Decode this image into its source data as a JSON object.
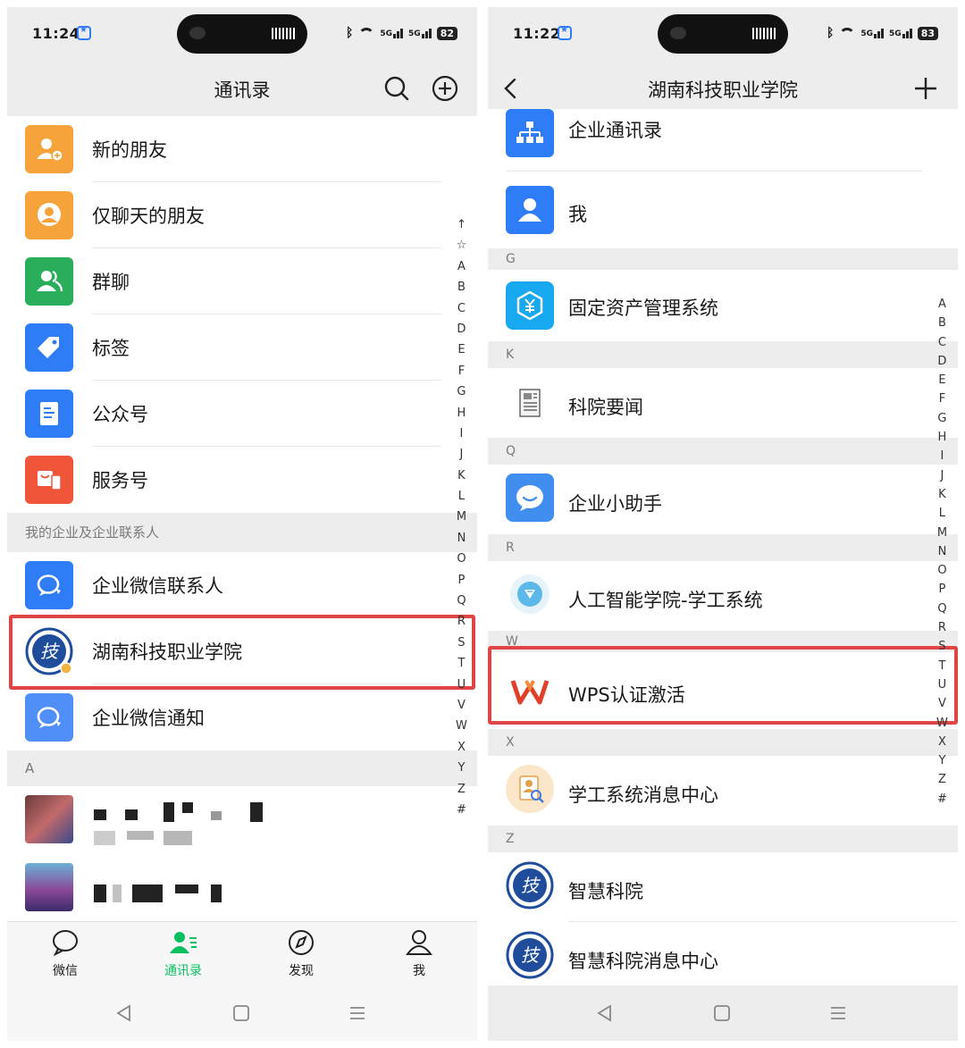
{
  "left": {
    "status": {
      "time": "11:24",
      "battery": "82",
      "sig1": "5G",
      "sig2": "5G"
    },
    "title": "通讯录",
    "menu": [
      {
        "label": "新的朋友",
        "icon": "new-friend-icon",
        "color": "#f5a33a"
      },
      {
        "label": "仅聊天的朋友",
        "icon": "chat-only-friend-icon",
        "color": "#f5a33a"
      },
      {
        "label": "群聊",
        "icon": "group-chat-icon",
        "color": "#2bae5b"
      },
      {
        "label": "标签",
        "icon": "tag-icon",
        "color": "#2e7cf6"
      },
      {
        "label": "公众号",
        "icon": "official-account-icon",
        "color": "#2e7cf6"
      },
      {
        "label": "服务号",
        "icon": "service-account-icon",
        "color": "#f0553a"
      }
    ],
    "enterprise_section": "我的企业及企业联系人",
    "enterprise": [
      {
        "label": "企业微信联系人",
        "icon": "wecom-contact-icon"
      },
      {
        "label": "湖南科技职业学院",
        "icon": "college-logo-icon"
      },
      {
        "label": "企业微信通知",
        "icon": "wecom-notice-icon"
      }
    ],
    "section_a": "A",
    "index_top": [
      "↑",
      "☆"
    ],
    "index": [
      "A",
      "B",
      "C",
      "D",
      "E",
      "F",
      "G",
      "H",
      "I",
      "J",
      "K",
      "L",
      "M",
      "N",
      "O",
      "P",
      "Q",
      "R",
      "S",
      "T",
      "U",
      "V",
      "W",
      "X",
      "Y",
      "Z",
      "#"
    ],
    "tabs": [
      {
        "label": "微信",
        "icon": "chat-bubble-icon",
        "active": false
      },
      {
        "label": "通讯录",
        "icon": "contacts-icon",
        "active": true
      },
      {
        "label": "发现",
        "icon": "compass-icon",
        "active": false
      },
      {
        "label": "我",
        "icon": "person-icon",
        "active": false
      }
    ]
  },
  "right": {
    "status": {
      "time": "11:22",
      "battery": "83",
      "sig1": "5G",
      "sig2": "5G"
    },
    "title": "湖南科技职业学院",
    "items_top": [
      {
        "label": "企业通讯录",
        "icon": "org-chart-icon"
      },
      {
        "label": "我",
        "icon": "person-icon"
      }
    ],
    "groups": [
      {
        "letter": "G",
        "items": [
          {
            "label": "固定资产管理系统",
            "icon": "asset-yen-icon"
          }
        ]
      },
      {
        "letter": "K",
        "items": [
          {
            "label": "科院要闻",
            "icon": "newspaper-icon"
          }
        ]
      },
      {
        "letter": "Q",
        "items": [
          {
            "label": "企业小助手",
            "icon": "assistant-chat-icon"
          }
        ]
      },
      {
        "letter": "R",
        "items": [
          {
            "label": "人工智能学院-学工系统",
            "icon": "ai-college-icon"
          }
        ]
      },
      {
        "letter": "W",
        "items": [
          {
            "label": "WPS认证激活",
            "icon": "wps-logo-icon"
          }
        ]
      },
      {
        "letter": "X",
        "items": [
          {
            "label": "学工系统消息中心",
            "icon": "student-affairs-icon"
          }
        ]
      },
      {
        "letter": "Z",
        "items": [
          {
            "label": "智慧科院",
            "icon": "college-logo-icon"
          },
          {
            "label": "智慧科院消息中心",
            "icon": "college-logo-icon"
          }
        ]
      }
    ],
    "index": [
      "A",
      "B",
      "C",
      "D",
      "E",
      "F",
      "G",
      "H",
      "I",
      "J",
      "K",
      "L",
      "M",
      "N",
      "O",
      "P",
      "Q",
      "R",
      "S",
      "T",
      "U",
      "V",
      "W",
      "X",
      "Y",
      "Z",
      "#"
    ]
  },
  "colors": {
    "accent_green": "#07c160",
    "highlight": "#e04545",
    "bg_gray": "#ededed"
  }
}
